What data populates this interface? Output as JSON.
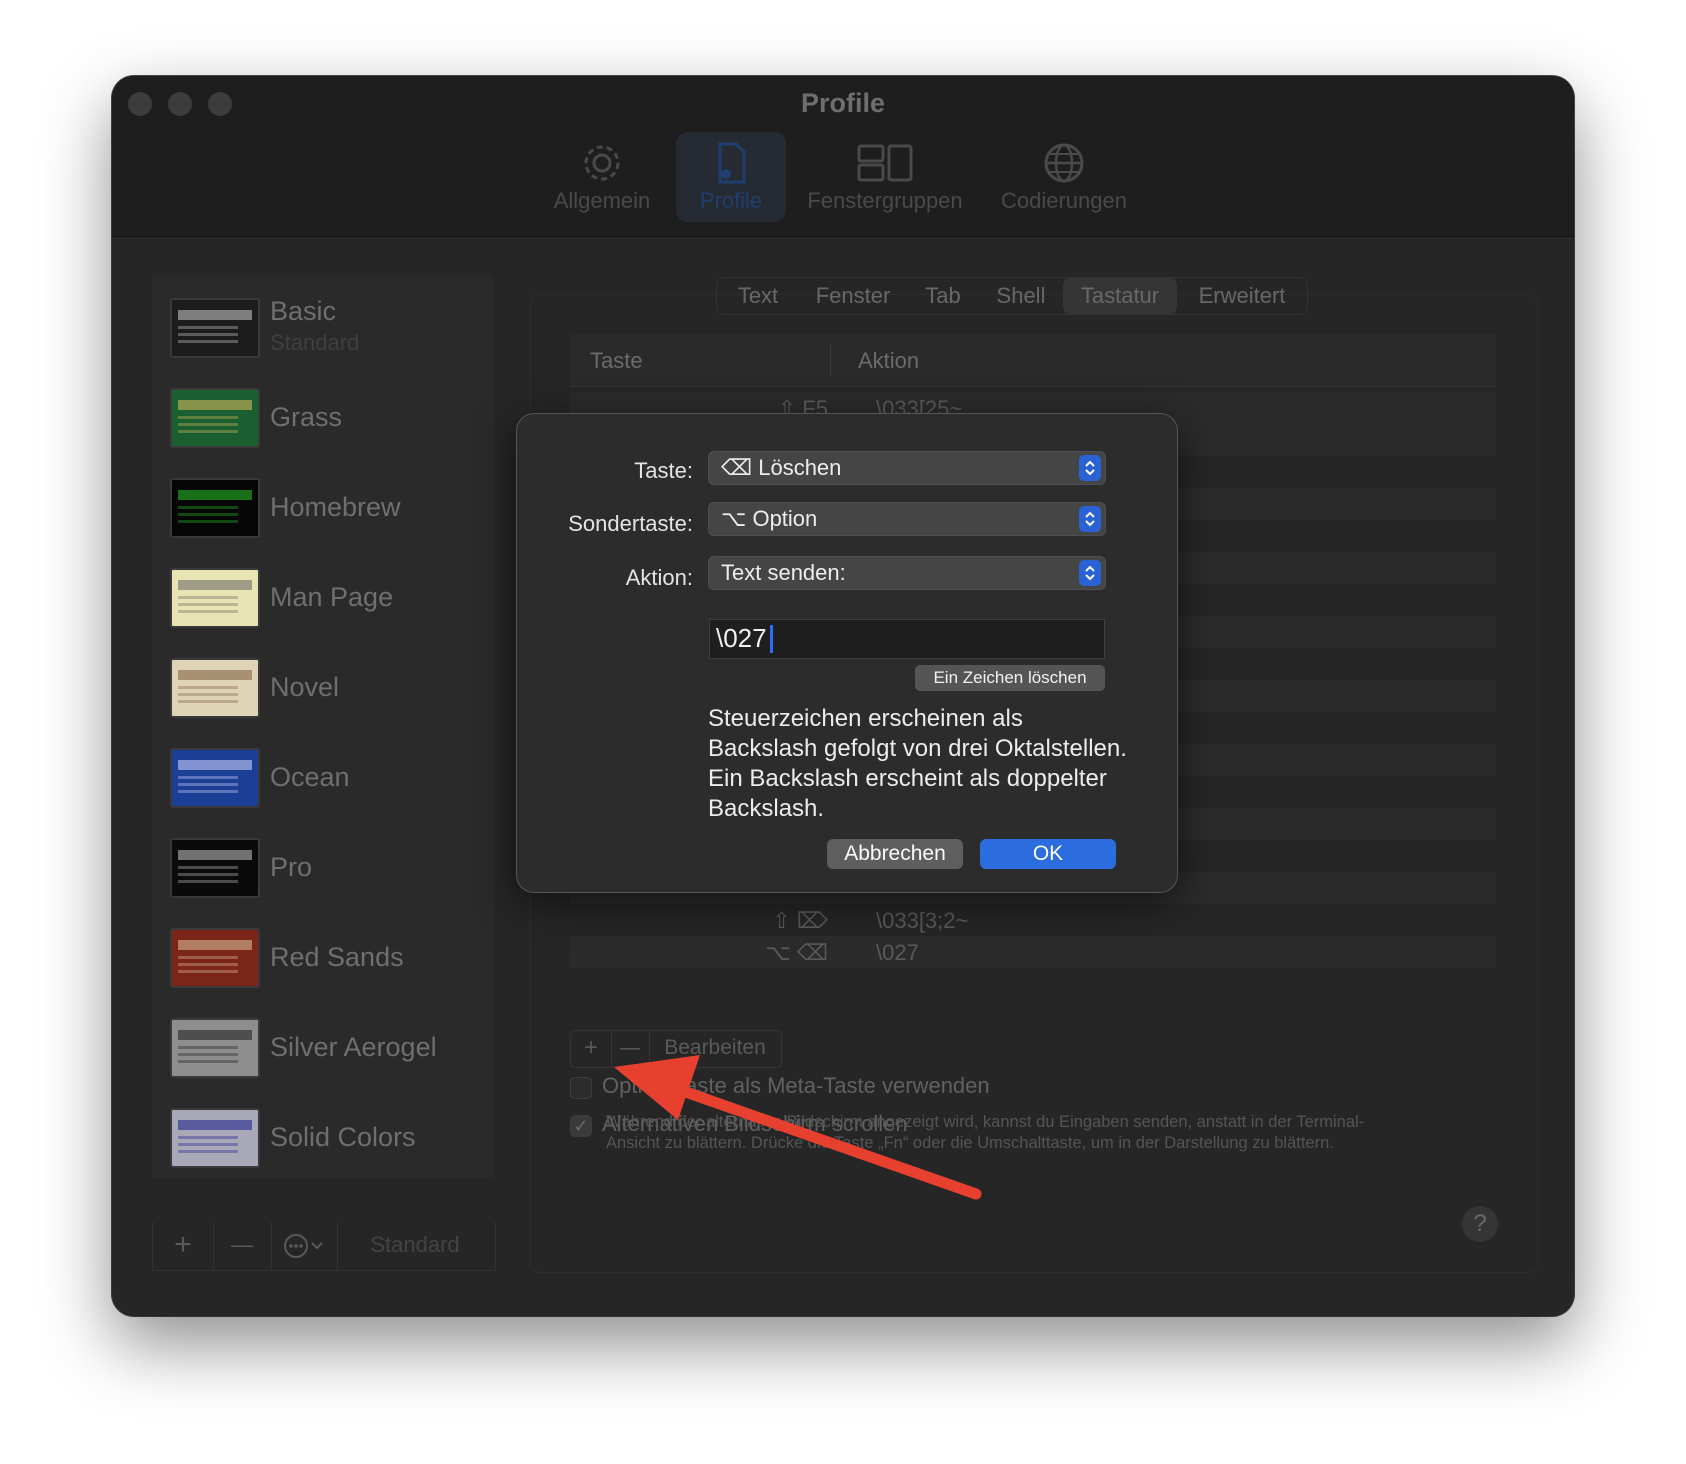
{
  "window": {
    "title": "Profile",
    "toolbar": [
      {
        "label": "Allgemein",
        "icon": "gear-icon"
      },
      {
        "label": "Profile",
        "icon": "document-gear-icon",
        "active": true
      },
      {
        "label": "Fenstergruppen",
        "icon": "window-groups-icon"
      },
      {
        "label": "Codierungen",
        "icon": "globe-icon"
      }
    ]
  },
  "sidebar": {
    "profiles": [
      {
        "name": "Basic",
        "subtitle": "Standard",
        "colors": {
          "bg": "#1c1c1c",
          "accent": "#d0d0d0"
        }
      },
      {
        "name": "Grass",
        "colors": {
          "bg": "#1b5e2f",
          "accent": "#e0c060"
        }
      },
      {
        "name": "Homebrew",
        "colors": {
          "bg": "#050505",
          "accent": "#28c828"
        }
      },
      {
        "name": "Man Page",
        "colors": {
          "bg": "#e8e4b4",
          "accent": "#606060"
        }
      },
      {
        "name": "Novel",
        "colors": {
          "bg": "#dfd4b8",
          "accent": "#7a5a3a"
        }
      },
      {
        "name": "Ocean",
        "colors": {
          "bg": "#1c3f96",
          "accent": "#d8d8ff"
        }
      },
      {
        "name": "Pro",
        "colors": {
          "bg": "#0a0a0a",
          "accent": "#c8c8c8"
        }
      },
      {
        "name": "Red Sands",
        "colors": {
          "bg": "#7a2518",
          "accent": "#e0c8a0"
        }
      },
      {
        "name": "Silver Aerogel",
        "colors": {
          "bg": "#8e8e8e",
          "accent": "#1a1a1a"
        }
      },
      {
        "name": "Solid Colors",
        "colors": {
          "bg": "#a8a8b8",
          "accent": "#1a1a8a"
        }
      }
    ],
    "bottom": {
      "add": "+",
      "remove": "—",
      "more_icon": "ellipsis-circle-icon",
      "default_label": "Standard"
    }
  },
  "tabs": [
    "Text",
    "Fenster",
    "Tab",
    "Shell",
    "Tastatur",
    "Erweitert"
  ],
  "active_tab": "Tastatur",
  "keytable": {
    "headers": {
      "key": "Taste",
      "action": "Aktion"
    },
    "rows": [
      {
        "key": "⇧ F5",
        "action": "\\033[25~"
      },
      {
        "key": "⇧ ⌦",
        "action": "\\033[3;2~"
      },
      {
        "key": "⌥ ⌫",
        "action": "\\027"
      }
    ]
  },
  "editbar": {
    "add": "+",
    "remove": "—",
    "edit": "Bearbeiten"
  },
  "options": {
    "meta_label": "Option-Taste als Meta-Taste verwenden",
    "alt_screen_label": "Alternativen Bildschirm scrollen",
    "description": "Während der alternative Bildschirm angezeigt wird, kannst du Eingaben senden, anstatt in der Terminal-Ansicht zu blättern. Drücke die Taste „Fn“ oder die Umschalttaste, um in der Darstellung zu blättern.",
    "help": "?"
  },
  "dialog": {
    "key_label": "Taste:",
    "key_value": "⌫ Löschen",
    "modifier_label": "Sondertaste:",
    "modifier_value": "⌥ Option",
    "action_label": "Aktion:",
    "action_value": "Text senden:",
    "text_value": "\\027",
    "delete_char_button": "Ein Zeichen löschen",
    "help_text": "Steuerzeichen erscheinen als Backslash gefolgt von drei Oktalstellen. Ein Backslash erscheint als doppelter Backslash.",
    "cancel": "Abbrechen",
    "ok": "OK"
  },
  "colors": {
    "accent": "#2b6ddf",
    "annotation_arrow": "#e8402e"
  }
}
